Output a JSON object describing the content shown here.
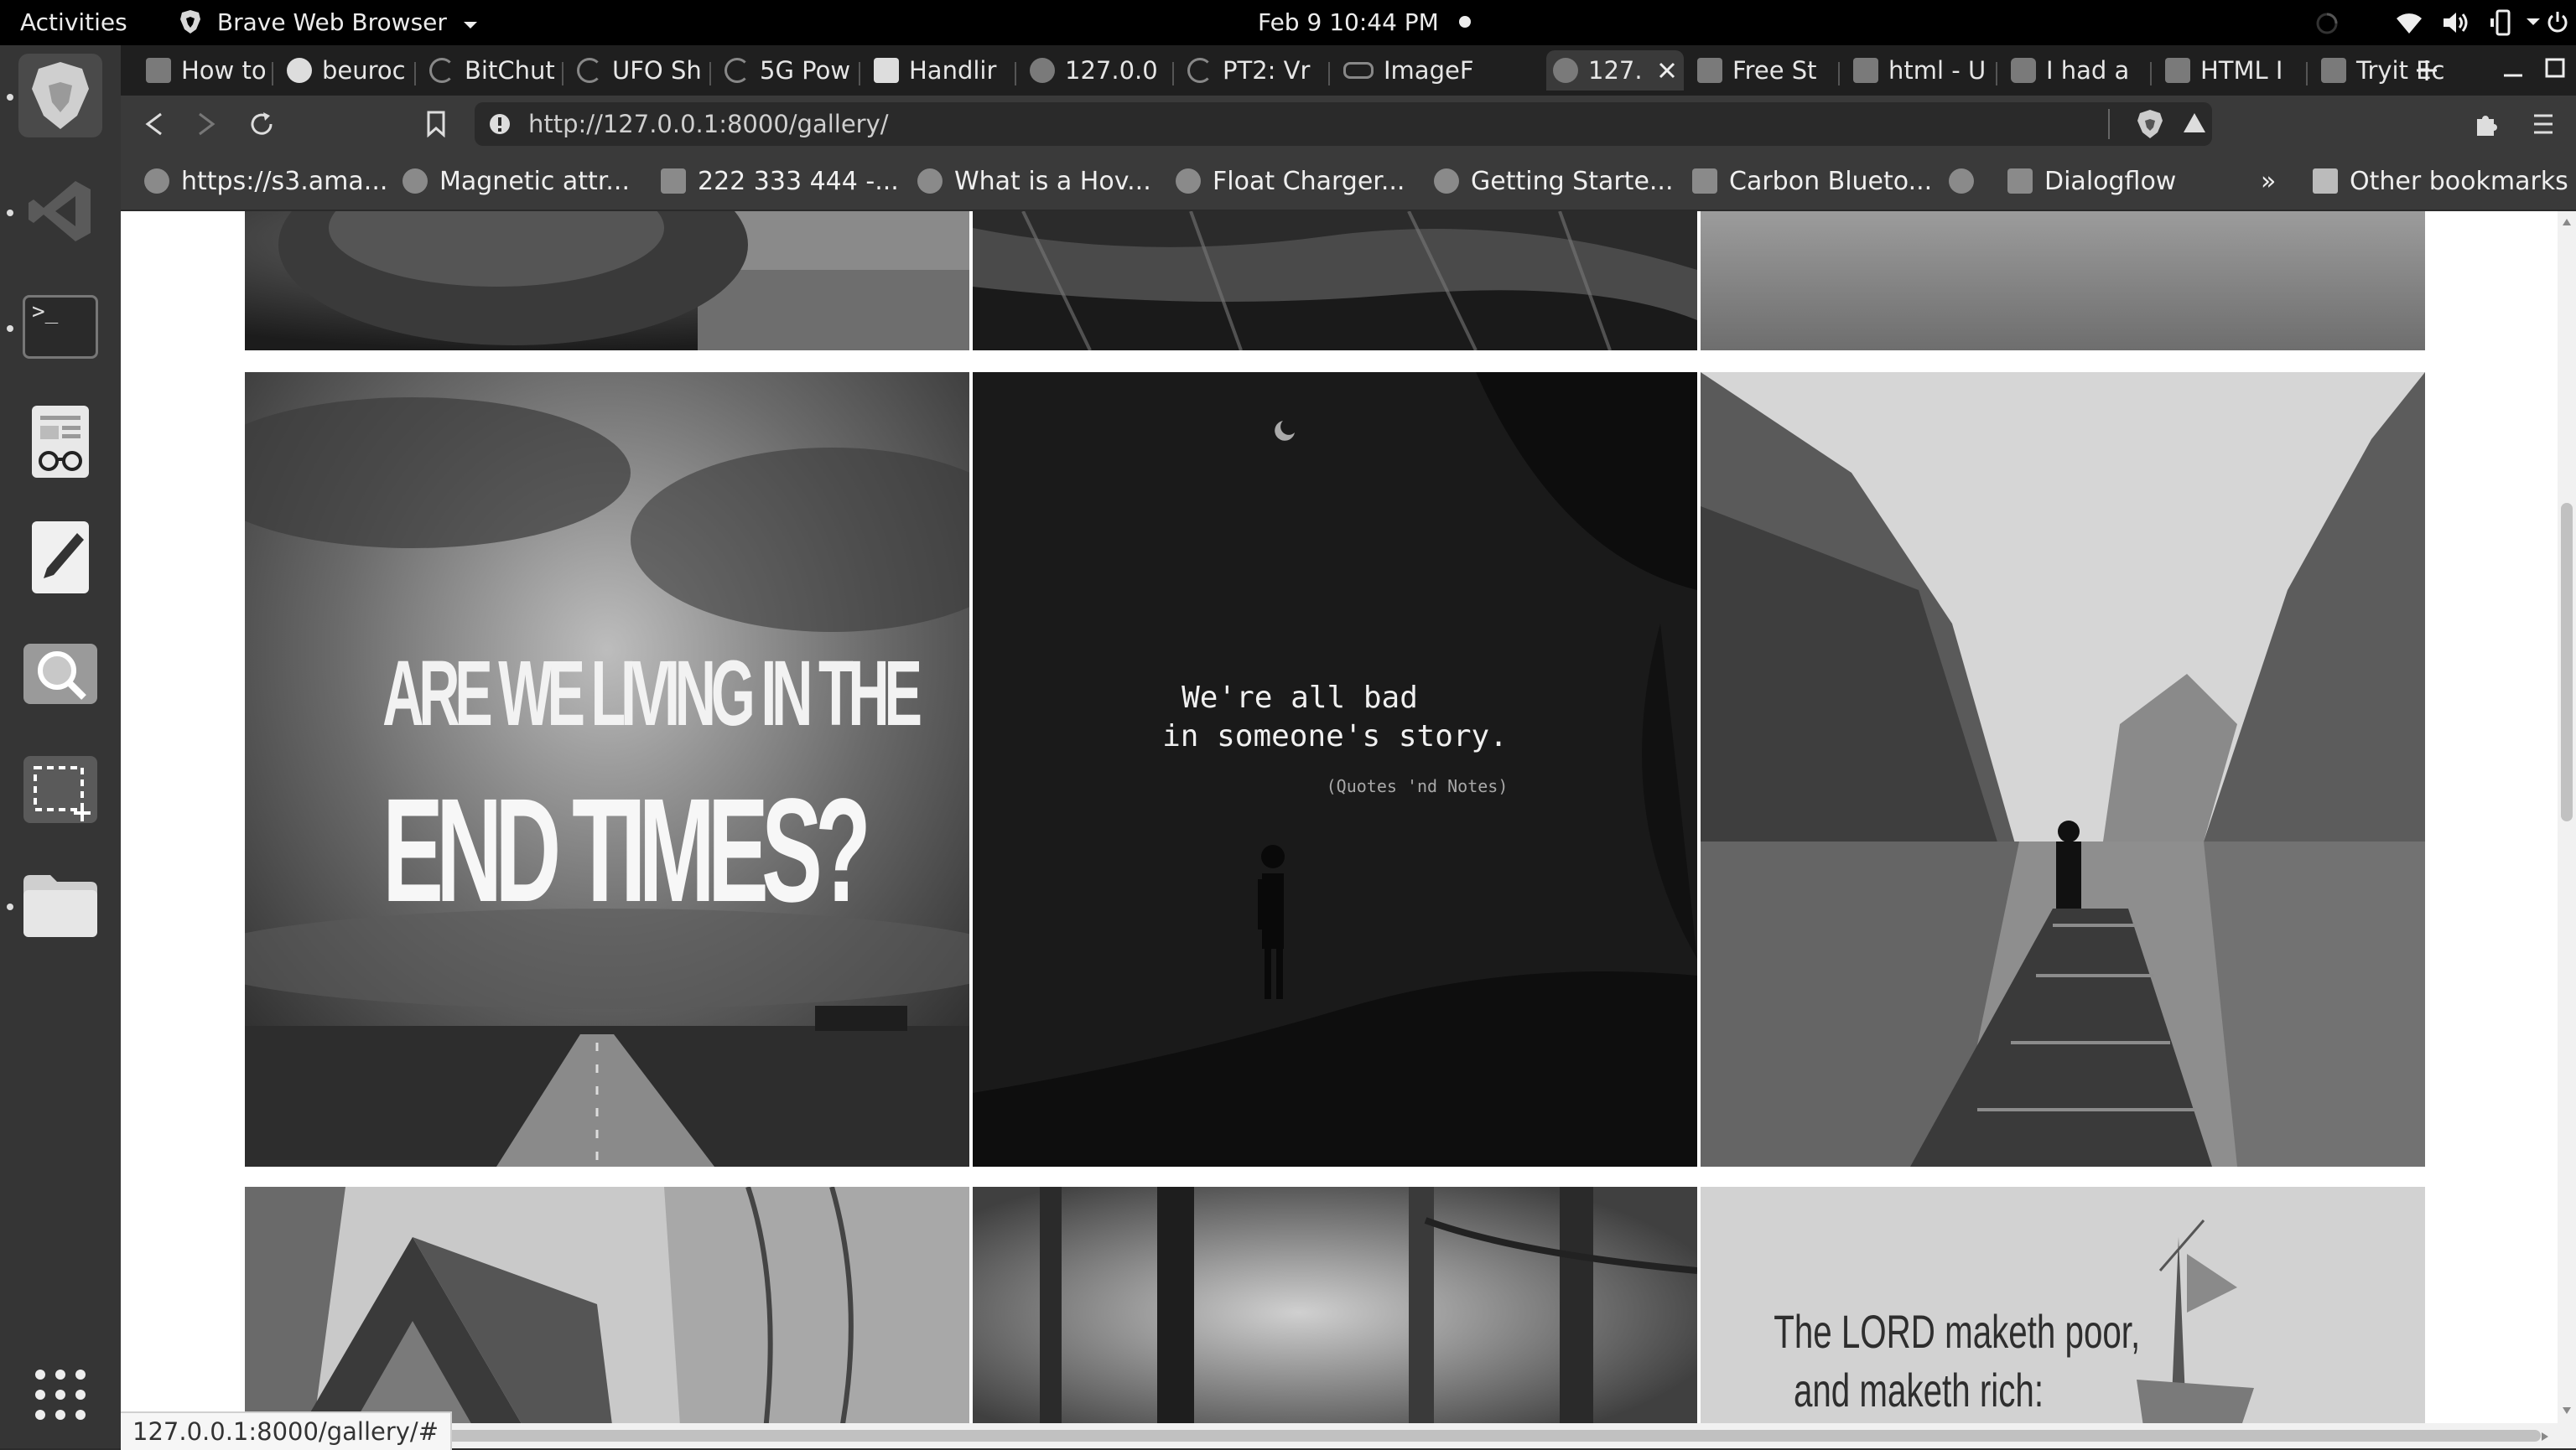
{
  "system_bar": {
    "activities": "Activities",
    "app_name": "Brave Web Browser",
    "clock": "Feb 9  10:44 PM"
  },
  "dock": {
    "items": [
      "brave-browser",
      "vscode",
      "terminal",
      "document-viewer",
      "text-editor",
      "image-viewer",
      "screenshot",
      "files",
      "show-applications"
    ]
  },
  "tabs": [
    {
      "label": "How to"
    },
    {
      "label": "beuroc"
    },
    {
      "label": "BitChut"
    },
    {
      "label": "UFO Sh"
    },
    {
      "label": "5G Pow"
    },
    {
      "label": "Handlir"
    },
    {
      "label": "127.0.0"
    },
    {
      "label": "PT2: Vr"
    },
    {
      "label": "ImageF"
    },
    {
      "label": "127.",
      "active": true
    },
    {
      "label": "Free St"
    },
    {
      "label": "html - U"
    },
    {
      "label": "I had a"
    },
    {
      "label": "HTML I"
    },
    {
      "label": "Tryit Ec"
    }
  ],
  "address_bar": {
    "url": "http://127.0.0.1:8000/gallery/"
  },
  "bookmarks": {
    "items": [
      {
        "label": "https://s3.ama..."
      },
      {
        "label": "Magnetic attr..."
      },
      {
        "label": "222 333 444 -..."
      },
      {
        "label": "What is a Hov..."
      },
      {
        "label": "Float Charger..."
      },
      {
        "label": "Getting Starte..."
      },
      {
        "label": "Carbon Blueto..."
      },
      {
        "label": ""
      },
      {
        "label": "Dialogflow"
      }
    ],
    "overflow": "»",
    "other": "Other bookmarks"
  },
  "gallery": {
    "quote_1_line_1": "ARE WE LIVING IN THE",
    "quote_1_line_2": "END TIMES?",
    "quote_2_line_1": "We're all bad",
    "quote_2_line_2": "in someone's story.",
    "quote_2_credit": "(Quotes 'nd Notes)",
    "quote_3_line_1": "The LORD maketh poor,",
    "quote_3_line_2": "and maketh rich:"
  },
  "status_bar": {
    "link": "127.0.0.1:8000/gallery/#"
  }
}
